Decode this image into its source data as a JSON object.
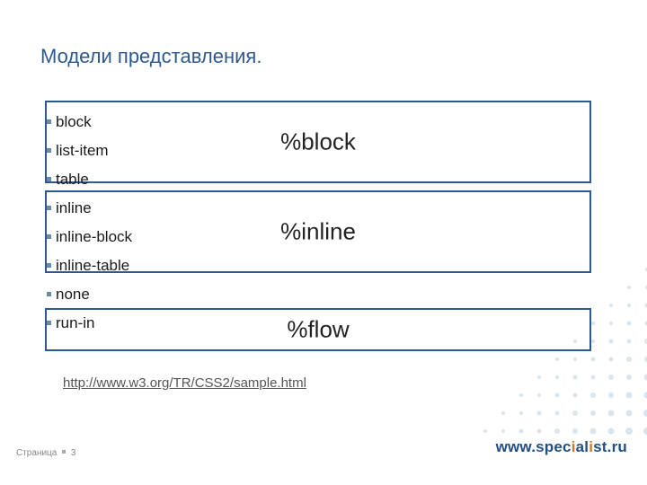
{
  "title": "Модели представления.",
  "list_items": [
    "block",
    "list-item",
    "table",
    "inline",
    "inline-block",
    "inline-table",
    "none",
    "run-in"
  ],
  "boxes": {
    "block": "%block",
    "inline": "%inline",
    "flow": "%flow"
  },
  "reference_link": "http://www.w3.org/TR/CSS2/sample.html",
  "footer": {
    "page_label": "Страница",
    "page_number": "3",
    "brand_plain_pre": "www.spec",
    "brand_accent": "i",
    "brand_plain_mid": "al",
    "brand_accent2": "i",
    "brand_plain_post": "st.ru"
  }
}
